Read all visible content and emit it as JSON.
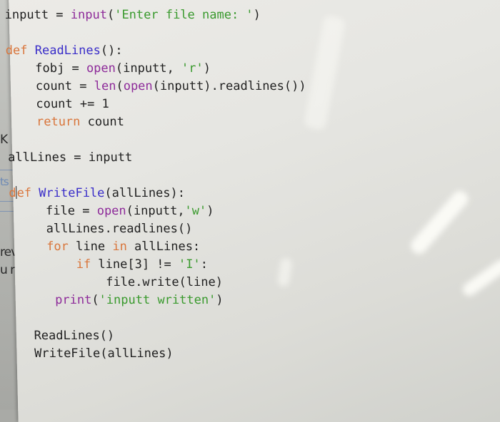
{
  "background_window": {
    "fragments": [
      "K",
      "ts",
      "rev",
      "u n"
    ]
  },
  "editor": {
    "lines": [
      {
        "parts": [
          [
            "plain",
            "inputt = "
          ],
          [
            "bi",
            "input"
          ],
          [
            "plain",
            "("
          ],
          [
            "str",
            "'Enter file name: '"
          ],
          [
            "plain",
            ")"
          ]
        ]
      },
      {
        "parts": []
      },
      {
        "parts": [
          [
            "kw",
            "def "
          ],
          [
            "fn",
            "ReadLines"
          ],
          [
            "plain",
            "():"
          ]
        ]
      },
      {
        "parts": [
          [
            "plain",
            "    fobj = "
          ],
          [
            "bi",
            "open"
          ],
          [
            "plain",
            "(inputt, "
          ],
          [
            "str",
            "'r'"
          ],
          [
            "plain",
            ")"
          ]
        ]
      },
      {
        "parts": [
          [
            "plain",
            "    count = "
          ],
          [
            "bi",
            "len"
          ],
          [
            "plain",
            "("
          ],
          [
            "bi",
            "open"
          ],
          [
            "plain",
            "(inputt).readlines())"
          ]
        ]
      },
      {
        "parts": [
          [
            "plain",
            "    count += 1"
          ]
        ]
      },
      {
        "parts": [
          [
            "kw",
            "    return"
          ],
          [
            "plain",
            " count"
          ]
        ]
      },
      {
        "parts": []
      },
      {
        "parts": [
          [
            "plain",
            "allLines = inputt"
          ]
        ]
      },
      {
        "parts": []
      },
      {
        "parts": [
          [
            "kw",
            "def "
          ],
          [
            "fn",
            "WriteFile"
          ],
          [
            "plain",
            "(allLines):"
          ]
        ]
      },
      {
        "parts": [
          [
            "plain",
            "     file = "
          ],
          [
            "bi",
            "open"
          ],
          [
            "plain",
            "(inputt,"
          ],
          [
            "str",
            "'w'"
          ],
          [
            "plain",
            ")"
          ]
        ]
      },
      {
        "parts": [
          [
            "plain",
            "     allLines.readlines()"
          ]
        ]
      },
      {
        "parts": [
          [
            "kw",
            "     for"
          ],
          [
            "plain",
            " line "
          ],
          [
            "kw",
            "in"
          ],
          [
            "plain",
            " allLines:"
          ]
        ]
      },
      {
        "parts": [
          [
            "kw",
            "         if"
          ],
          [
            "plain",
            " line[3] != "
          ],
          [
            "str",
            "'I'"
          ],
          [
            "plain",
            ":"
          ]
        ]
      },
      {
        "parts": [
          [
            "plain",
            "             file.write(line)"
          ]
        ]
      },
      {
        "parts": [
          [
            "bi",
            "      print"
          ],
          [
            "plain",
            "("
          ],
          [
            "str",
            "'inputt written'"
          ],
          [
            "plain",
            ")"
          ]
        ]
      },
      {
        "parts": []
      },
      {
        "parts": [
          [
            "plain",
            "   ReadLines()"
          ]
        ]
      },
      {
        "parts": [
          [
            "plain",
            "   WriteFile(allLines)"
          ]
        ]
      }
    ]
  }
}
